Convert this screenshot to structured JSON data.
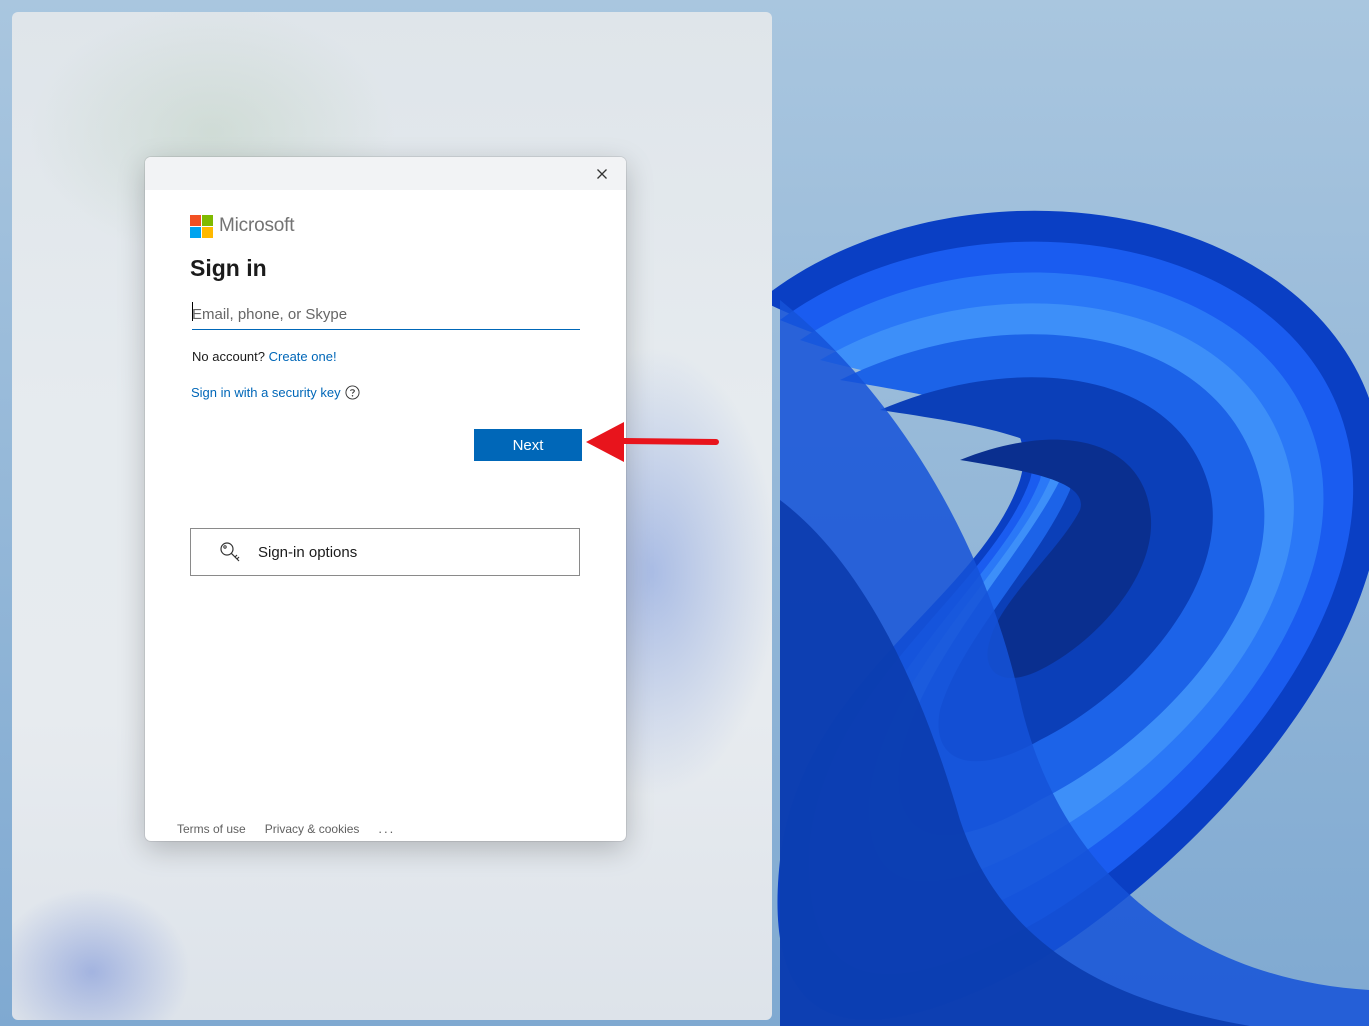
{
  "logo": {
    "name": "Microsoft",
    "colors": [
      "#f25022",
      "#7fba00",
      "#00a4ef",
      "#ffb900"
    ]
  },
  "signin": {
    "title": "Sign in",
    "email_placeholder": "Email, phone, or Skype",
    "email_value": "",
    "no_account_text": "No account?",
    "create_link": "Create one!",
    "security_key_link": "Sign in with a security key",
    "help_icon": "question-circle-icon",
    "next_label": "Next",
    "options_label": "Sign-in options",
    "options_icon": "key-search-icon"
  },
  "titlebar": {
    "close_icon": "close-icon"
  },
  "footer": {
    "terms": "Terms of use",
    "privacy": "Privacy & cookies",
    "more": "..."
  },
  "colors": {
    "accent": "#0067b8",
    "annotation_arrow": "#e8141c"
  }
}
